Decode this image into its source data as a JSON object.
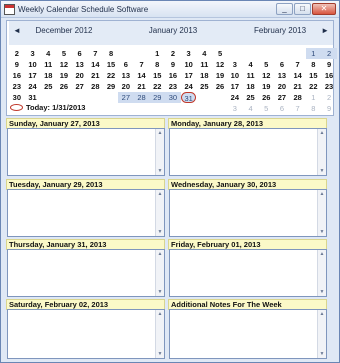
{
  "window": {
    "title": "Weekly Calendar Schedule Software",
    "minimize": "_",
    "maximize": "□",
    "close": "✕"
  },
  "calendar": {
    "nav_prev": "◄",
    "nav_next": "►",
    "today_label": "Today: 1/31/2013",
    "months": [
      {
        "name": "December 2012",
        "rows": [
          [
            {
              "d": "2"
            },
            {
              "d": "3"
            },
            {
              "d": "4"
            },
            {
              "d": "5"
            },
            {
              "d": "6"
            },
            {
              "d": "7"
            },
            {
              "d": "8"
            }
          ],
          [
            {
              "d": "9"
            },
            {
              "d": "10"
            },
            {
              "d": "11"
            },
            {
              "d": "12"
            },
            {
              "d": "13"
            },
            {
              "d": "14"
            },
            {
              "d": "15"
            }
          ],
          [
            {
              "d": "16"
            },
            {
              "d": "17"
            },
            {
              "d": "18"
            },
            {
              "d": "19"
            },
            {
              "d": "20"
            },
            {
              "d": "21"
            },
            {
              "d": "22"
            }
          ],
          [
            {
              "d": "23"
            },
            {
              "d": "24"
            },
            {
              "d": "25"
            },
            {
              "d": "26"
            },
            {
              "d": "27"
            },
            {
              "d": "28"
            },
            {
              "d": "29"
            }
          ],
          [
            {
              "d": "30"
            },
            {
              "d": "31"
            }
          ]
        ]
      },
      {
        "name": "January 2013",
        "rows": [
          [
            null,
            null,
            {
              "d": "1"
            },
            {
              "d": "2"
            },
            {
              "d": "3"
            },
            {
              "d": "4"
            },
            {
              "d": "5"
            }
          ],
          [
            {
              "d": "6"
            },
            {
              "d": "7"
            },
            {
              "d": "8"
            },
            {
              "d": "9"
            },
            {
              "d": "10"
            },
            {
              "d": "11"
            },
            {
              "d": "12"
            }
          ],
          [
            {
              "d": "13"
            },
            {
              "d": "14"
            },
            {
              "d": "15"
            },
            {
              "d": "16"
            },
            {
              "d": "17"
            },
            {
              "d": "18"
            },
            {
              "d": "19"
            }
          ],
          [
            {
              "d": "20"
            },
            {
              "d": "21"
            },
            {
              "d": "22"
            },
            {
              "d": "23"
            },
            {
              "d": "24"
            },
            {
              "d": "25"
            },
            {
              "d": "26"
            }
          ],
          [
            {
              "d": "27",
              "s": "sel"
            },
            {
              "d": "28",
              "s": "sel"
            },
            {
              "d": "29",
              "s": "sel"
            },
            {
              "d": "30",
              "s": "sel"
            },
            {
              "d": "31",
              "s": "today"
            }
          ]
        ]
      },
      {
        "name": "February 2013",
        "rows": [
          [
            null,
            null,
            null,
            null,
            null,
            {
              "d": "1",
              "s": "sel"
            },
            {
              "d": "2",
              "s": "sel"
            }
          ],
          [
            {
              "d": "3"
            },
            {
              "d": "4"
            },
            {
              "d": "5"
            },
            {
              "d": "6"
            },
            {
              "d": "7"
            },
            {
              "d": "8"
            },
            {
              "d": "9"
            }
          ],
          [
            {
              "d": "10"
            },
            {
              "d": "11"
            },
            {
              "d": "12"
            },
            {
              "d": "13"
            },
            {
              "d": "14"
            },
            {
              "d": "15"
            },
            {
              "d": "16"
            }
          ],
          [
            {
              "d": "17"
            },
            {
              "d": "18"
            },
            {
              "d": "19"
            },
            {
              "d": "20"
            },
            {
              "d": "21"
            },
            {
              "d": "22"
            },
            {
              "d": "23"
            }
          ],
          [
            {
              "d": "24"
            },
            {
              "d": "25"
            },
            {
              "d": "26"
            },
            {
              "d": "27"
            },
            {
              "d": "28"
            },
            {
              "d": "1",
              "s": "dim"
            },
            {
              "d": "2",
              "s": "dim"
            }
          ],
          [
            {
              "d": "3",
              "s": "dim"
            },
            {
              "d": "4",
              "s": "dim"
            },
            {
              "d": "5",
              "s": "dim"
            },
            {
              "d": "6",
              "s": "dim"
            },
            {
              "d": "7",
              "s": "dim"
            },
            {
              "d": "8",
              "s": "dim"
            },
            {
              "d": "9",
              "s": "dim"
            }
          ]
        ]
      }
    ]
  },
  "panels": [
    {
      "title": "Sunday, January 27, 2013"
    },
    {
      "title": "Monday, January 28, 2013"
    },
    {
      "title": "Tuesday, January 29, 2013"
    },
    {
      "title": "Wednesday, January 30, 2013"
    },
    {
      "title": "Thursday, January 31, 2013"
    },
    {
      "title": "Friday, February 01, 2013"
    },
    {
      "title": "Saturday, February 02, 2013"
    },
    {
      "title": "Additional Notes For The Week"
    }
  ],
  "scroll_up": "▲",
  "scroll_down": "▼"
}
